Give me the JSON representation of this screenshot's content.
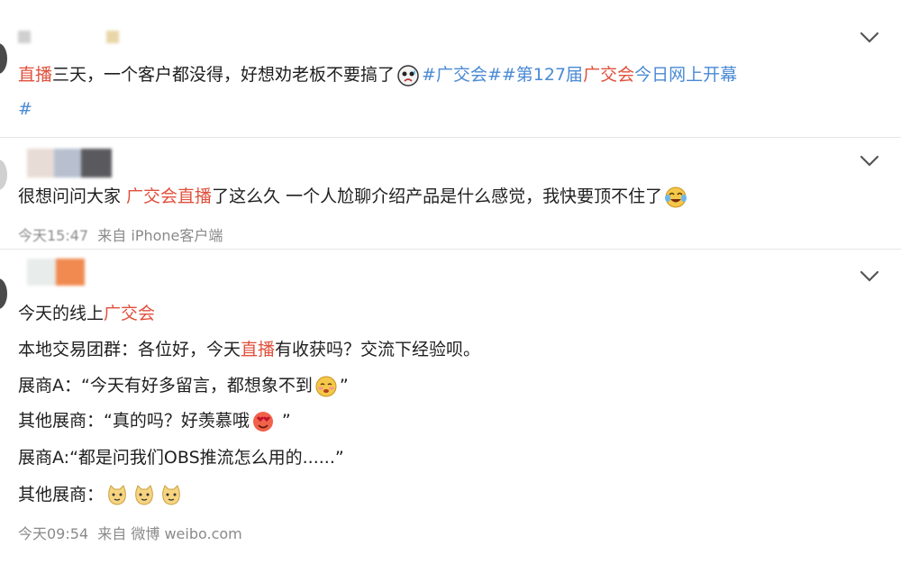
{
  "post1": {
    "highlight": "直播",
    "text": "三天，一个客户都没得，好想劝老板不要搞了",
    "hashtag1": "#广交会#",
    "hashtag2_prefix": "#第127届",
    "hashtag2_red": "广交会",
    "hashtag2_suffix": "今日网上开幕",
    "hashtag2_end": "#"
  },
  "post2": {
    "text_before": "很想问问大家 ",
    "highlight": "广交会直播",
    "text_after": "了这么久 一个人尬聊介绍产品是什么感觉，我快要顶不住了",
    "meta_time": "今天15:47",
    "meta_source": "来自 iPhone客户端"
  },
  "post3": {
    "line1_before": "今天的线上",
    "line1_highlight": "广交会",
    "line2_before": "本地交易团群：各位好，今天",
    "line2_highlight": "直播",
    "line2_after": "有收获吗？交流下经验呗。",
    "line3_before": "展商A：“今天有好多留言，都想象不到",
    "line3_after": "”",
    "line4_before": "其他展商：“真的吗？好羡慕哦",
    "line4_after": " ”",
    "line5": "展商A:“都是问我们OBS推流怎么用的......”",
    "line6": "其他展商：",
    "meta_time": "今天09:54",
    "meta_source": "来自 微博 weibo.com"
  },
  "colors": {
    "accent_red": "#e0503c",
    "link_blue": "#4a8ad4",
    "meta_gray": "#8a8a8a"
  },
  "icons": {
    "chevron": "chevron-down-icon",
    "laugh_cry": "laugh-cry-emoji-icon",
    "cat": "cat-emoji-icon",
    "shy": "shy-emoji-icon",
    "heart_eyes": "heart-eyes-emoji-icon",
    "sad_sweat": "sad-sweat-emoji-icon"
  }
}
